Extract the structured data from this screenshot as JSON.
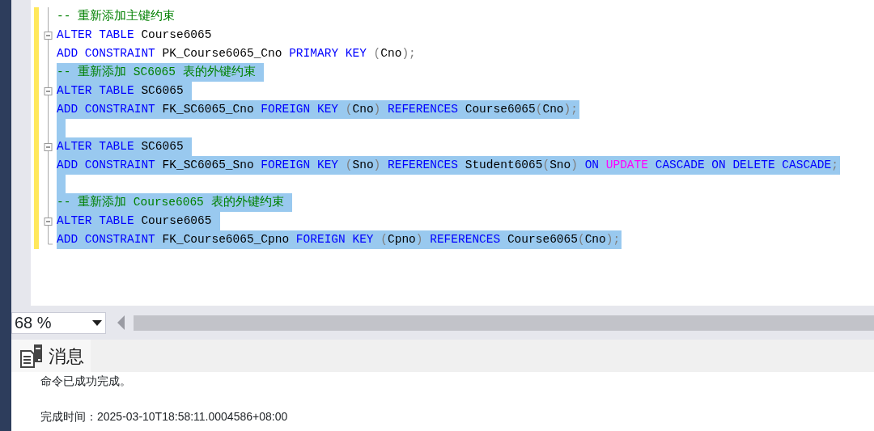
{
  "editor": {
    "lines": [
      {
        "collapsible": false,
        "selected": false,
        "tokens": [
          {
            "kind": "comment",
            "text": "-- 重新添加主键约束"
          }
        ]
      },
      {
        "collapsible": true,
        "selected": false,
        "tokens": [
          {
            "kind": "keyword",
            "text": "ALTER TABLE "
          },
          {
            "kind": "plain",
            "text": "Course6065"
          }
        ]
      },
      {
        "collapsible": false,
        "selected": false,
        "tokens": [
          {
            "kind": "keyword",
            "text": "ADD CONSTRAINT "
          },
          {
            "kind": "plain",
            "text": "PK_Course6065_Cno "
          },
          {
            "kind": "keyword",
            "text": "PRIMARY KEY "
          },
          {
            "kind": "gray",
            "text": "("
          },
          {
            "kind": "plain",
            "text": "Cno"
          },
          {
            "kind": "gray",
            "text": ");"
          }
        ]
      },
      {
        "collapsible": false,
        "selected": true,
        "tokens": [
          {
            "kind": "comment",
            "text": "-- 重新添加 SC6065 表的外键约束 "
          }
        ]
      },
      {
        "collapsible": true,
        "selected": true,
        "tokens": [
          {
            "kind": "keyword",
            "text": "ALTER TABLE "
          },
          {
            "kind": "plain",
            "text": "SC6065 "
          }
        ]
      },
      {
        "collapsible": false,
        "selected": true,
        "tokens": [
          {
            "kind": "keyword",
            "text": "ADD CONSTRAINT "
          },
          {
            "kind": "plain",
            "text": "FK_SC6065_Cno "
          },
          {
            "kind": "keyword",
            "text": "FOREIGN KEY "
          },
          {
            "kind": "gray",
            "text": "("
          },
          {
            "kind": "plain",
            "text": "Cno"
          },
          {
            "kind": "gray",
            "text": ") "
          },
          {
            "kind": "keyword",
            "text": "REFERENCES "
          },
          {
            "kind": "plain",
            "text": "Course6065"
          },
          {
            "kind": "gray",
            "text": "("
          },
          {
            "kind": "plain",
            "text": "Cno"
          },
          {
            "kind": "gray",
            "text": ");"
          }
        ]
      },
      {
        "collapsible": false,
        "selected": true
      },
      {
        "collapsible": true,
        "selected": true,
        "tokens": [
          {
            "kind": "keyword",
            "text": "ALTER TABLE "
          },
          {
            "kind": "plain",
            "text": "SC6065 "
          }
        ]
      },
      {
        "collapsible": false,
        "selected": true,
        "tokens": [
          {
            "kind": "keyword",
            "text": "ADD CONSTRAINT "
          },
          {
            "kind": "plain",
            "text": "FK_SC6065_Sno "
          },
          {
            "kind": "keyword",
            "text": "FOREIGN KEY "
          },
          {
            "kind": "gray",
            "text": "("
          },
          {
            "kind": "plain",
            "text": "Sno"
          },
          {
            "kind": "gray",
            "text": ") "
          },
          {
            "kind": "keyword",
            "text": "REFERENCES "
          },
          {
            "kind": "plain",
            "text": "Student6065"
          },
          {
            "kind": "gray",
            "text": "("
          },
          {
            "kind": "plain",
            "text": "Sno"
          },
          {
            "kind": "gray",
            "text": ") "
          },
          {
            "kind": "keyword",
            "text": "ON "
          },
          {
            "kind": "pink",
            "text": "UPDATE "
          },
          {
            "kind": "keyword",
            "text": "CASCADE ON DELETE CASCADE"
          },
          {
            "kind": "gray",
            "text": ";"
          }
        ]
      },
      {
        "collapsible": false,
        "selected": true
      },
      {
        "collapsible": false,
        "selected": true,
        "tokens": [
          {
            "kind": "comment",
            "text": "-- 重新添加 Course6065 表的外键约束 "
          }
        ]
      },
      {
        "collapsible": true,
        "selected": true,
        "tokens": [
          {
            "kind": "keyword",
            "text": "ALTER TABLE "
          },
          {
            "kind": "plain",
            "text": "Course6065 "
          }
        ]
      },
      {
        "collapsible": false,
        "selected": true,
        "tokens": [
          {
            "kind": "keyword",
            "text": "ADD CONSTRAINT "
          },
          {
            "kind": "plain",
            "text": "FK_Course6065_Cpno "
          },
          {
            "kind": "keyword",
            "text": "FOREIGN KEY "
          },
          {
            "kind": "gray",
            "text": "("
          },
          {
            "kind": "plain",
            "text": "Cpno"
          },
          {
            "kind": "gray",
            "text": ") "
          },
          {
            "kind": "keyword",
            "text": "REFERENCES "
          },
          {
            "kind": "plain",
            "text": "Course6065"
          },
          {
            "kind": "gray",
            "text": "("
          },
          {
            "kind": "plain",
            "text": "Cno"
          },
          {
            "kind": "gray",
            "text": ");"
          }
        ]
      }
    ]
  },
  "zoom": {
    "value": "68 %"
  },
  "results": {
    "tabs": [
      {
        "label": "消息",
        "selected": true
      }
    ],
    "messages": [
      "命令已成功完成。",
      "完成时间：2025-03-10T18:58:11.0004586+08:00"
    ]
  }
}
